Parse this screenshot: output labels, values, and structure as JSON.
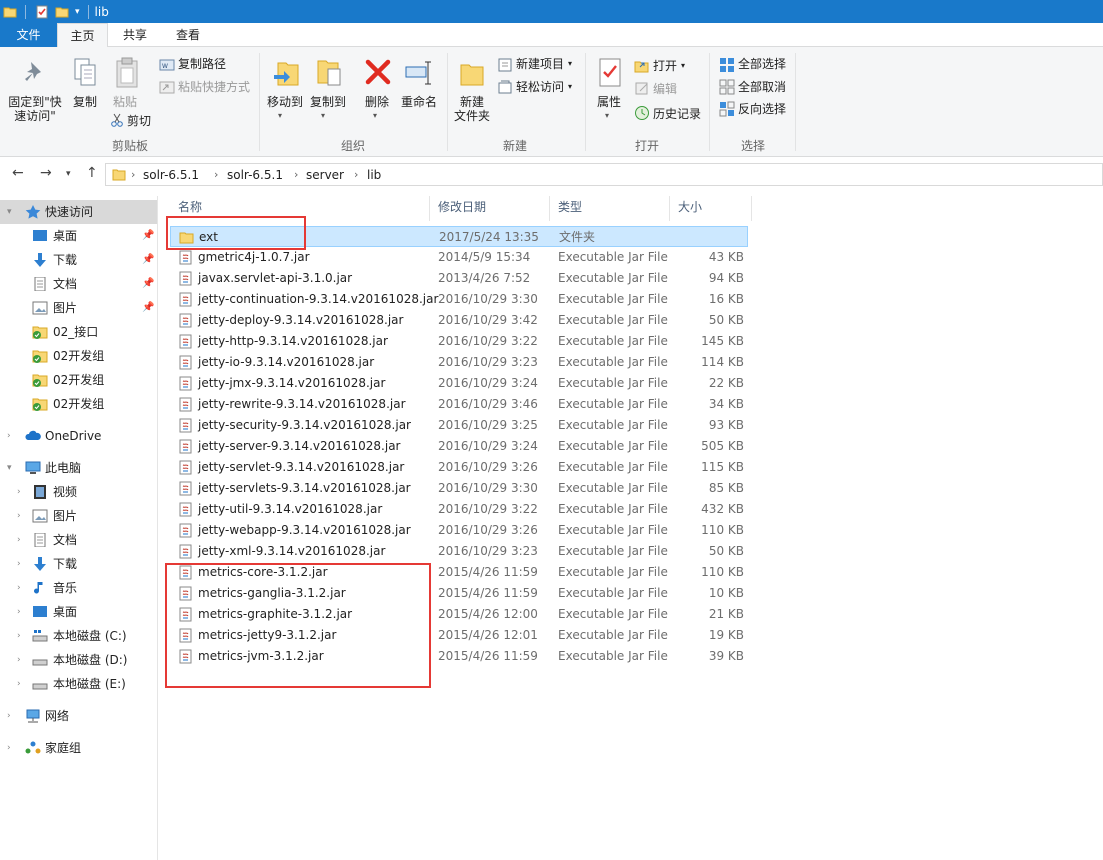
{
  "window": {
    "title": "lib"
  },
  "tabs": [
    {
      "label": "文件"
    },
    {
      "label": "主页"
    },
    {
      "label": "共享"
    },
    {
      "label": "查看"
    }
  ],
  "ribbon": {
    "clipboard": {
      "pin_line1": "固定到\"快",
      "pin_line2": "速访问\"",
      "copy": "复制",
      "paste": "粘贴",
      "copy_path": "复制路径",
      "paste_shortcut": "粘贴快捷方式",
      "cut": "剪切",
      "group": "剪贴板"
    },
    "organize": {
      "move_to": "移动到",
      "copy_to": "复制到",
      "delete": "删除",
      "rename": "重命名",
      "group": "组织"
    },
    "new": {
      "new_folder_line1": "新建",
      "new_folder_line2": "文件夹",
      "new_item": "新建项目",
      "easy_access": "轻松访问",
      "group": "新建"
    },
    "open": {
      "properties": "属性",
      "open": "打开",
      "edit": "编辑",
      "history": "历史记录",
      "group": "打开"
    },
    "select": {
      "select_all": "全部选择",
      "select_none": "全部取消",
      "invert": "反向选择",
      "group": "选择"
    }
  },
  "address": {
    "crumbs": [
      "solr-6.5.1",
      "solr-6.5.1",
      "server",
      "lib"
    ],
    "separator": "›"
  },
  "nav": {
    "quick_access": "快速访问",
    "desktop": "桌面",
    "downloads": "下载",
    "documents": "文档",
    "pictures": "图片",
    "f1": "02_接口",
    "f2": "02开发组",
    "f3": "02开发组",
    "f4": "02开发组",
    "onedrive": "OneDrive",
    "this_pc": "此电脑",
    "videos": "视频",
    "pc_pictures": "图片",
    "pc_documents": "文档",
    "pc_downloads": "下载",
    "music": "音乐",
    "pc_desktop": "桌面",
    "disk_c": "本地磁盘 (C:)",
    "disk_d": "本地磁盘 (D:)",
    "disk_e": "本地磁盘 (E:)",
    "network": "网络",
    "homegroup": "家庭组"
  },
  "columns": {
    "name": "名称",
    "date": "修改日期",
    "type": "类型",
    "size": "大小"
  },
  "files": [
    {
      "name": "ext",
      "date": "2017/5/24 13:35",
      "type": "文件夹",
      "size": ""
    },
    {
      "name": "gmetric4j-1.0.7.jar",
      "date": "2014/5/9 15:34",
      "type": "Executable Jar File",
      "size": "43 KB"
    },
    {
      "name": "javax.servlet-api-3.1.0.jar",
      "date": "2013/4/26 7:52",
      "type": "Executable Jar File",
      "size": "94 KB"
    },
    {
      "name": "jetty-continuation-9.3.14.v20161028.jar",
      "date": "2016/10/29 3:30",
      "type": "Executable Jar File",
      "size": "16 KB"
    },
    {
      "name": "jetty-deploy-9.3.14.v20161028.jar",
      "date": "2016/10/29 3:42",
      "type": "Executable Jar File",
      "size": "50 KB"
    },
    {
      "name": "jetty-http-9.3.14.v20161028.jar",
      "date": "2016/10/29 3:22",
      "type": "Executable Jar File",
      "size": "145 KB"
    },
    {
      "name": "jetty-io-9.3.14.v20161028.jar",
      "date": "2016/10/29 3:23",
      "type": "Executable Jar File",
      "size": "114 KB"
    },
    {
      "name": "jetty-jmx-9.3.14.v20161028.jar",
      "date": "2016/10/29 3:24",
      "type": "Executable Jar File",
      "size": "22 KB"
    },
    {
      "name": "jetty-rewrite-9.3.14.v20161028.jar",
      "date": "2016/10/29 3:46",
      "type": "Executable Jar File",
      "size": "34 KB"
    },
    {
      "name": "jetty-security-9.3.14.v20161028.jar",
      "date": "2016/10/29 3:25",
      "type": "Executable Jar File",
      "size": "93 KB"
    },
    {
      "name": "jetty-server-9.3.14.v20161028.jar",
      "date": "2016/10/29 3:24",
      "type": "Executable Jar File",
      "size": "505 KB"
    },
    {
      "name": "jetty-servlet-9.3.14.v20161028.jar",
      "date": "2016/10/29 3:26",
      "type": "Executable Jar File",
      "size": "115 KB"
    },
    {
      "name": "jetty-servlets-9.3.14.v20161028.jar",
      "date": "2016/10/29 3:30",
      "type": "Executable Jar File",
      "size": "85 KB"
    },
    {
      "name": "jetty-util-9.3.14.v20161028.jar",
      "date": "2016/10/29 3:22",
      "type": "Executable Jar File",
      "size": "432 KB"
    },
    {
      "name": "jetty-webapp-9.3.14.v20161028.jar",
      "date": "2016/10/29 3:26",
      "type": "Executable Jar File",
      "size": "110 KB"
    },
    {
      "name": "jetty-xml-9.3.14.v20161028.jar",
      "date": "2016/10/29 3:23",
      "type": "Executable Jar File",
      "size": "50 KB"
    },
    {
      "name": "metrics-core-3.1.2.jar",
      "date": "2015/4/26 11:59",
      "type": "Executable Jar File",
      "size": "110 KB"
    },
    {
      "name": "metrics-ganglia-3.1.2.jar",
      "date": "2015/4/26 11:59",
      "type": "Executable Jar File",
      "size": "10 KB"
    },
    {
      "name": "metrics-graphite-3.1.2.jar",
      "date": "2015/4/26 12:00",
      "type": "Executable Jar File",
      "size": "21 KB"
    },
    {
      "name": "metrics-jetty9-3.1.2.jar",
      "date": "2015/4/26 12:01",
      "type": "Executable Jar File",
      "size": "19 KB"
    },
    {
      "name": "metrics-jvm-3.1.2.jar",
      "date": "2015/4/26 11:59",
      "type": "Executable Jar File",
      "size": "39 KB"
    }
  ],
  "colors": {
    "title_bar": "#1979ca",
    "selection": "#cce8ff",
    "annotation_red": "#e53935",
    "folder_yellow": "#f8d775"
  }
}
